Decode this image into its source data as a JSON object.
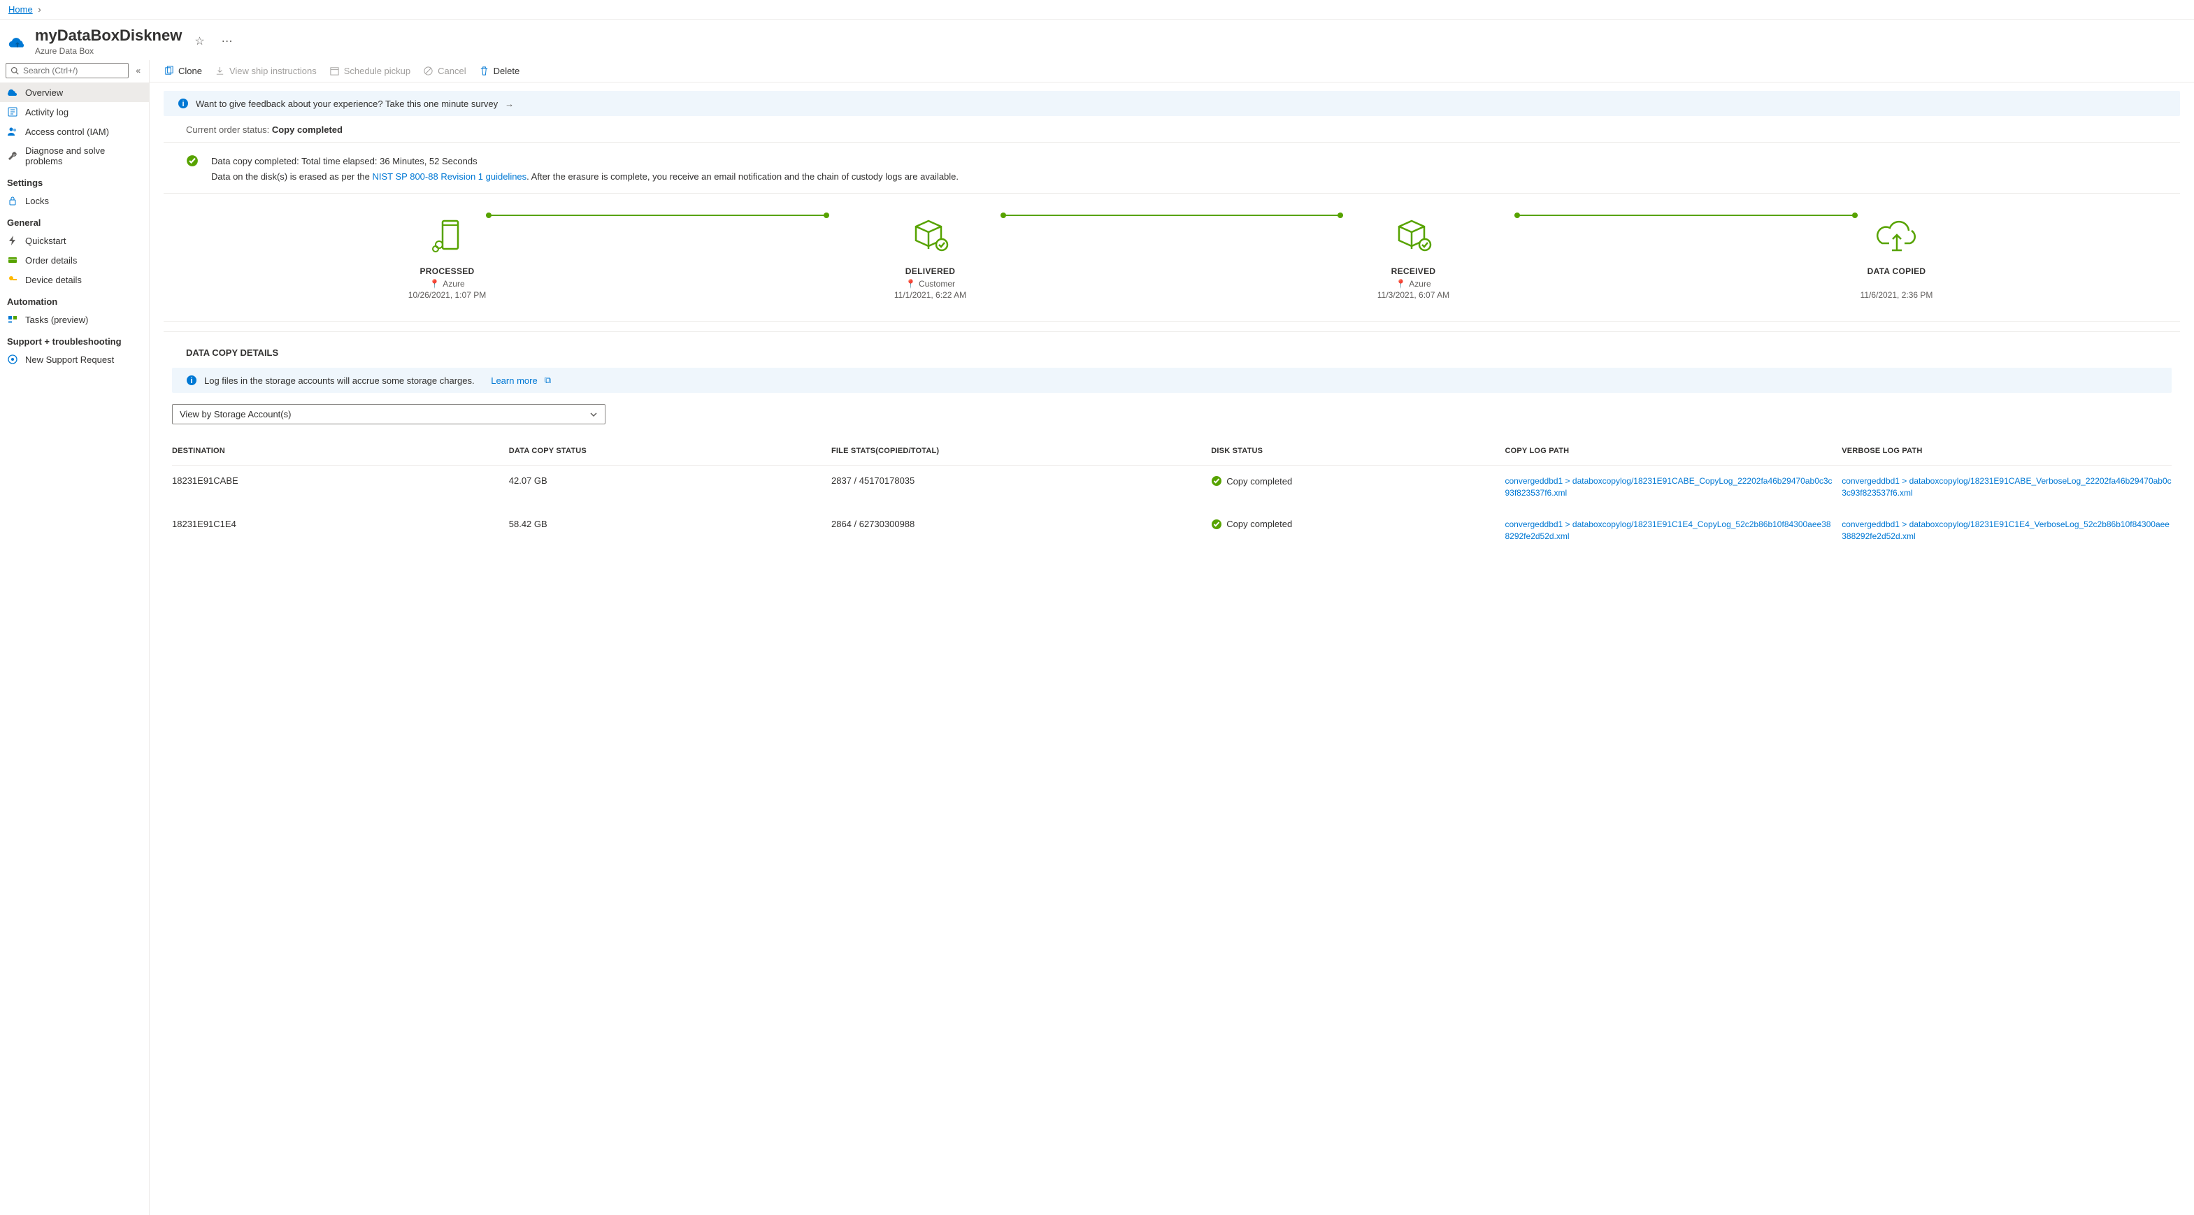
{
  "breadcrumb": {
    "home": "Home"
  },
  "header": {
    "title": "myDataBoxDisknew",
    "subtitle": "Azure Data Box"
  },
  "search": {
    "placeholder": "Search (Ctrl+/)"
  },
  "nav": {
    "items": [
      {
        "label": "Overview"
      },
      {
        "label": "Activity log"
      },
      {
        "label": "Access control (IAM)"
      },
      {
        "label": "Diagnose and solve problems"
      }
    ],
    "groups": [
      {
        "title": "Settings",
        "items": [
          {
            "label": "Locks"
          }
        ]
      },
      {
        "title": "General",
        "items": [
          {
            "label": "Quickstart"
          },
          {
            "label": "Order details"
          },
          {
            "label": "Device details"
          }
        ]
      },
      {
        "title": "Automation",
        "items": [
          {
            "label": "Tasks (preview)"
          }
        ]
      },
      {
        "title": "Support + troubleshooting",
        "items": [
          {
            "label": "New Support Request"
          }
        ]
      }
    ]
  },
  "toolbar": {
    "clone": "Clone",
    "ship": "View ship instructions",
    "schedule": "Schedule pickup",
    "cancel": "Cancel",
    "delete": "Delete"
  },
  "feedback": {
    "text": "Want to give feedback about your experience? Take this one minute survey"
  },
  "status": {
    "label": "Current order status: ",
    "value": "Copy completed"
  },
  "summary": {
    "line1": "Data copy completed: Total time elapsed: 36 Minutes, 52 Seconds",
    "line2a": "Data on the disk(s) is erased as per the ",
    "link": "NIST SP 800-88 Revision 1 guidelines",
    "line2b": ". After the erasure is complete, you receive an email notification and the chain of custody logs are available."
  },
  "stages": [
    {
      "label": "PROCESSED",
      "sub": "Azure",
      "date": "10/26/2021, 1:07 PM"
    },
    {
      "label": "DELIVERED",
      "sub": "Customer",
      "date": "11/1/2021, 6:22 AM"
    },
    {
      "label": "RECEIVED",
      "sub": "Azure",
      "date": "11/3/2021, 6:07 AM"
    },
    {
      "label": "DATA COPIED",
      "sub": "",
      "date": "11/6/2021, 2:36 PM"
    }
  ],
  "copyDetails": {
    "title": "DATA COPY DETAILS",
    "info": "Log files in the storage accounts will accrue some storage charges.",
    "learn": "Learn more",
    "dropdown": "View by Storage Account(s)",
    "headers": {
      "dest": "DESTINATION",
      "status": "DATA COPY STATUS",
      "files": "FILE STATS(COPIED/TOTAL)",
      "disk": "DISK STATUS",
      "copylog": "COPY LOG PATH",
      "verbose": "VERBOSE LOG PATH"
    },
    "rows": [
      {
        "dest": "18231E91CABE",
        "status": "42.07 GB",
        "files": "2837 / 45170178035",
        "disk": "Copy completed",
        "copylog": "convergeddbd1 > databoxcopylog/18231E91CABE_CopyLog_22202fa46b29470ab0c3c93f823537f6.xml",
        "verbose": "convergeddbd1 > databoxcopylog/18231E91CABE_VerboseLog_22202fa46b29470ab0c3c93f823537f6.xml"
      },
      {
        "dest": "18231E91C1E4",
        "status": "58.42 GB",
        "files": "2864 / 62730300988",
        "disk": "Copy completed",
        "copylog": "convergeddbd1 > databoxcopylog/18231E91C1E4_CopyLog_52c2b86b10f84300aee388292fe2d52d.xml",
        "verbose": "convergeddbd1 > databoxcopylog/18231E91C1E4_VerboseLog_52c2b86b10f84300aee388292fe2d52d.xml"
      }
    ]
  }
}
